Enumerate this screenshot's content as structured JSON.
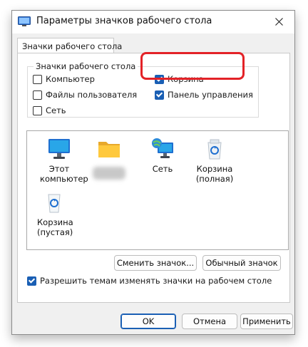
{
  "window": {
    "title": "Параметры значков рабочего стола"
  },
  "tab": {
    "label": "Значки рабочего стола"
  },
  "group": {
    "title": "Значки рабочего стола",
    "items": [
      {
        "label": "Компьютер",
        "checked": false
      },
      {
        "label": "Файлы пользователя",
        "checked": false
      },
      {
        "label": "Сеть",
        "checked": false
      },
      {
        "label": "Корзина",
        "checked": true
      },
      {
        "label": "Панель управления",
        "checked": true
      }
    ]
  },
  "icons": [
    {
      "label": "Этот компьютер",
      "icon": "monitor-icon"
    },
    {
      "label": "",
      "icon": "folder-icon"
    },
    {
      "label": "Сеть",
      "icon": "network-icon"
    },
    {
      "label": "Корзина (полная)",
      "icon": "recycle-bin-full-icon"
    },
    {
      "label": "Корзина (пустая)",
      "icon": "recycle-bin-empty-icon"
    }
  ],
  "buttons": {
    "change_icon": "Сменить значок...",
    "default_icon": "Обычный значок",
    "ok": "OK",
    "cancel": "Отмена",
    "apply": "Применить"
  },
  "theme_option": {
    "label": "Разрешить темам изменять значки на рабочем столе",
    "checked": true
  },
  "colors": {
    "accent": "#1a5fb4",
    "highlight": "#e32227"
  }
}
